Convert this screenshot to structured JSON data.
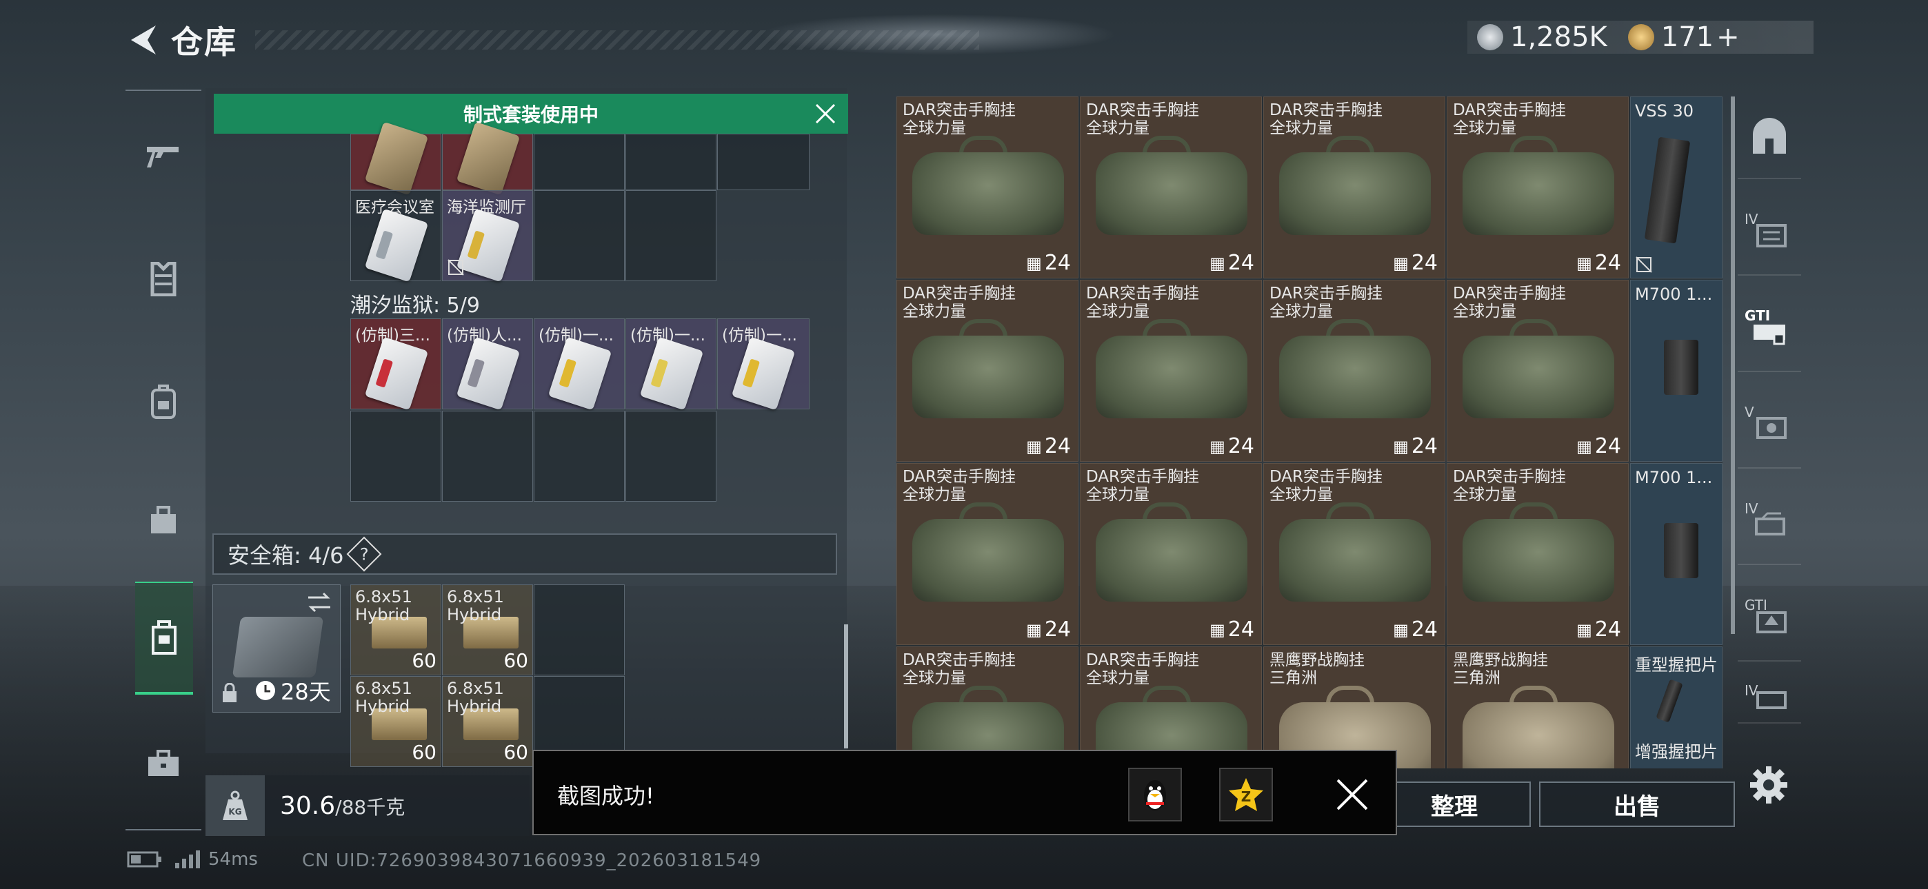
{
  "header": {
    "title": "仓库"
  },
  "currency": {
    "silver": "1,285K",
    "gold": "171",
    "gold_plus": "+"
  },
  "banner": {
    "text": "制式套装使用中"
  },
  "keycards_top": [
    {
      "label": ""
    },
    {
      "label": ""
    }
  ],
  "keycards_row2": [
    {
      "label": "医疗会议室"
    },
    {
      "label": "海洋监测厅"
    }
  ],
  "prison": {
    "label": "潮汐监狱: 5/9",
    "cards": [
      {
        "label": "(仿制)三..."
      },
      {
        "label": "(仿制)人..."
      },
      {
        "label": "(仿制)一..."
      },
      {
        "label": "(仿制)一..."
      },
      {
        "label": "(仿制)一..."
      }
    ]
  },
  "safebox": {
    "label": "安全箱: 4/6",
    "help": "?",
    "duration": "28天",
    "ammo": [
      {
        "label": "6.8x51 Hybrid",
        "count": "60"
      },
      {
        "label": "6.8x51 Hybrid",
        "count": "60"
      },
      {
        "label": "6.8x51 Hybrid",
        "count": "60"
      },
      {
        "label": "6.8x51 Hybrid",
        "count": "60"
      }
    ]
  },
  "weight": {
    "current": "30.6",
    "max": "/88千克"
  },
  "stash": {
    "rows": [
      {
        "bags": [
          {
            "name": "DAR突击手胸挂",
            "sub": "全球力量",
            "count": "24"
          },
          {
            "name": "DAR突击手胸挂",
            "sub": "全球力量",
            "count": "24"
          },
          {
            "name": "DAR突击手胸挂",
            "sub": "全球力量",
            "count": "24"
          },
          {
            "name": "DAR突击手胸挂",
            "sub": "全球力量",
            "count": "24"
          }
        ],
        "side": "VSS 30"
      },
      {
        "bags": [
          {
            "name": "DAR突击手胸挂",
            "sub": "全球力量",
            "count": "24"
          },
          {
            "name": "DAR突击手胸挂",
            "sub": "全球力量",
            "count": "24"
          },
          {
            "name": "DAR突击手胸挂",
            "sub": "全球力量",
            "count": "24"
          },
          {
            "name": "DAR突击手胸挂",
            "sub": "全球力量",
            "count": "24"
          }
        ],
        "side": "M700 1..."
      },
      {
        "bags": [
          {
            "name": "DAR突击手胸挂",
            "sub": "全球力量",
            "count": "24"
          },
          {
            "name": "DAR突击手胸挂",
            "sub": "全球力量",
            "count": "24"
          },
          {
            "name": "DAR突击手胸挂",
            "sub": "全球力量",
            "count": "24"
          },
          {
            "name": "DAR突击手胸挂",
            "sub": "全球力量",
            "count": "24"
          }
        ],
        "side": "M700 1..."
      },
      {
        "bags": [
          {
            "name": "DAR突击手胸挂",
            "sub": "全球力量",
            "count": ""
          },
          {
            "name": "DAR突击手胸挂",
            "sub": "全球力量",
            "count": ""
          },
          {
            "name": "黑鹰野战胸挂",
            "sub": "三角洲",
            "count": ""
          },
          {
            "name": "黑鹰野战胸挂",
            "sub": "三角洲",
            "count": ""
          }
        ],
        "side": "重型握把片",
        "side2": "增强握把片"
      }
    ]
  },
  "right_tabs": [
    "",
    "IV",
    "GTI",
    "V",
    "IV",
    "GTI",
    "IV"
  ],
  "buttons": {
    "sort": "整理",
    "sell": "出售"
  },
  "toast": {
    "message": "截图成功!"
  },
  "status": {
    "ping": "54ms",
    "uid": "CN UID:7269039843071660939_202603181549"
  },
  "colors": {
    "accent": "#1a8a5c",
    "active_tab": "#38d08a"
  }
}
